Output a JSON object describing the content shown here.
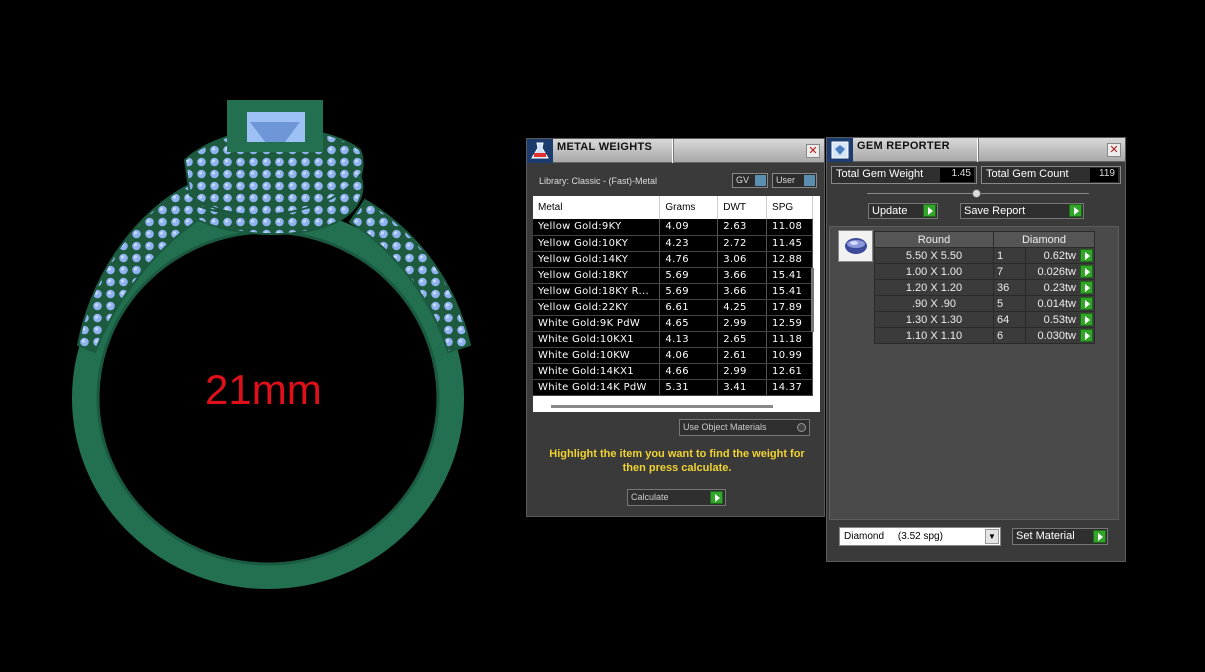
{
  "ring": {
    "size_label": "21mm"
  },
  "metal_weights": {
    "title": "METAL WEIGHTS",
    "library": "Library: Classic - (Fast)-Metal",
    "toggles": [
      "GV",
      "User"
    ],
    "columns": [
      "Metal",
      "Grams",
      "DWT",
      "SPG"
    ],
    "rows": [
      [
        "Yellow Gold:9KY",
        "4.09",
        "2.63",
        "11.08"
      ],
      [
        "Yellow Gold:10KY",
        "4.23",
        "2.72",
        "11.45"
      ],
      [
        "Yellow Gold:14KY",
        "4.76",
        "3.06",
        "12.88"
      ],
      [
        "Yellow Gold:18KY",
        "5.69",
        "3.66",
        "15.41"
      ],
      [
        "Yellow Gold:18KY R...",
        "5.69",
        "3.66",
        "15.41"
      ],
      [
        "Yellow Gold:22KY",
        "6.61",
        "4.25",
        "17.89"
      ],
      [
        "White Gold:9K PdW",
        "4.65",
        "2.99",
        "12.59"
      ],
      [
        "White Gold:10KX1",
        "4.13",
        "2.65",
        "11.18"
      ],
      [
        "White Gold:10KW",
        "4.06",
        "2.61",
        "10.99"
      ],
      [
        "White Gold:14KX1",
        "4.66",
        "2.99",
        "12.61"
      ],
      [
        "White Gold:14K PdW",
        "5.31",
        "3.41",
        "14.37"
      ]
    ],
    "use_object_materials": "Use Object Materials",
    "hint": "Highlight the item you want to find the weight for then press calculate.",
    "calculate": "Calculate"
  },
  "gem_reporter": {
    "title": "GEM REPORTER",
    "total_weight_label": "Total Gem Weight",
    "total_weight_value": "1.45",
    "total_count_label": "Total Gem Count",
    "total_count_value": "119",
    "update": "Update",
    "save_report": "Save Report",
    "header_shape": "Round",
    "header_material": "Diamond",
    "rows": [
      {
        "size": "5.50 X 5.50",
        "count": "1",
        "tw": "0.62tw"
      },
      {
        "size": "1.00 X 1.00",
        "count": "7",
        "tw": "0.026tw"
      },
      {
        "size": "1.20 X 1.20",
        "count": "36",
        "tw": "0.23tw"
      },
      {
        "size": ".90 X .90",
        "count": "5",
        "tw": "0.014tw"
      },
      {
        "size": "1.30 X 1.30",
        "count": "64",
        "tw": "0.53tw"
      },
      {
        "size": "1.10 X 1.10",
        "count": "6",
        "tw": "0.030tw"
      }
    ],
    "material_select": "Diamond     (3.52 spg)",
    "set_material": "Set Material"
  }
}
